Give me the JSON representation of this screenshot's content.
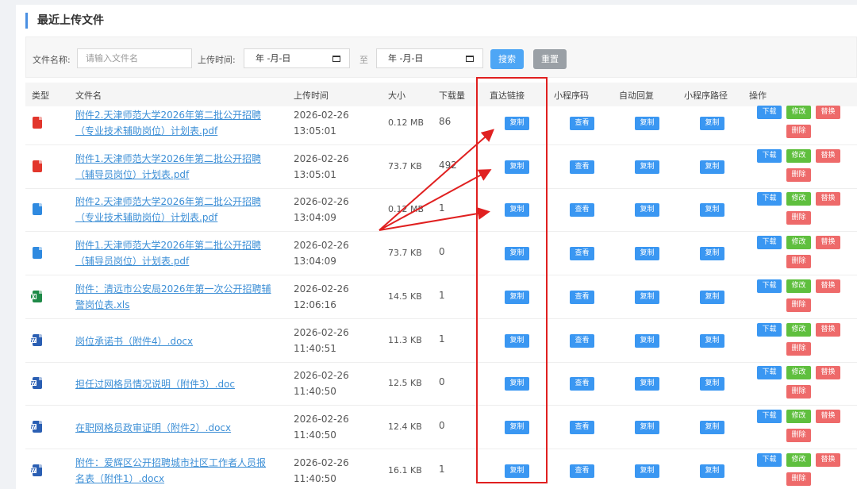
{
  "title": "最近上传文件",
  "filter": {
    "name_label": "文件名称:",
    "name_placeholder": "请输入文件名",
    "time_label": "上传时间:",
    "date_from": "年 -月-日",
    "to_label": "至",
    "date_to": "年 -月-日",
    "search": "搜索",
    "reset": "重置"
  },
  "columns": {
    "type": "类型",
    "name": "文件名",
    "time": "上传时间",
    "size": "大小",
    "downloads": "下载量",
    "direct_link": "直达链接",
    "mini_code": "小程序码",
    "auto_reply": "自动回复",
    "mini_path": "小程序路径",
    "actions": "操作"
  },
  "buttons": {
    "copy": "复制",
    "view": "查看",
    "download": "下载",
    "edit": "修改",
    "replace": "替换",
    "delete": "删除"
  },
  "rows": [
    {
      "type": "pdf",
      "name": "附件2.天津师范大学2026年第二批公开招聘（专业技术辅助岗位）计划表.pdf",
      "date": "2026-02-26",
      "time": "13:05:01",
      "size": "0.12 MB",
      "downloads": "86"
    },
    {
      "type": "pdf",
      "name": "附件1.天津师范大学2026年第二批公开招聘（辅导员岗位）计划表.pdf",
      "date": "2026-02-26",
      "time": "13:05:01",
      "size": "73.7 KB",
      "downloads": "492"
    },
    {
      "type": "doc-blue",
      "name": "附件2.天津师范大学2026年第二批公开招聘（专业技术辅助岗位）计划表.pdf",
      "date": "2026-02-26",
      "time": "13:04:09",
      "size": "0.12 MB",
      "downloads": "1"
    },
    {
      "type": "doc-blue",
      "name": "附件1.天津师范大学2026年第二批公开招聘（辅导员岗位）计划表.pdf",
      "date": "2026-02-26",
      "time": "13:04:09",
      "size": "73.7 KB",
      "downloads": "0"
    },
    {
      "type": "xls",
      "name": "附件：清远市公安局2026年第一次公开招聘辅警岗位表.xls",
      "date": "2026-02-26",
      "time": "12:06:16",
      "size": "14.5 KB",
      "downloads": "1"
    },
    {
      "type": "word",
      "name": "岗位承诺书（附件4）.docx",
      "date": "2026-02-26",
      "time": "11:40:51",
      "size": "11.3 KB",
      "downloads": "1"
    },
    {
      "type": "word",
      "name": "担任过网格员情况说明（附件3）.doc",
      "date": "2026-02-26",
      "time": "11:40:50",
      "size": "12.5 KB",
      "downloads": "0"
    },
    {
      "type": "word",
      "name": "在职网格员政审证明（附件2）.docx",
      "date": "2026-02-26",
      "time": "11:40:50",
      "size": "12.4 KB",
      "downloads": "0"
    },
    {
      "type": "word",
      "name": "附件：爱辉区公开招聘城市社区工作者人员报名表（附件1）.docx",
      "date": "2026-02-26",
      "time": "11:40:50",
      "size": "16.1 KB",
      "downloads": "1"
    }
  ],
  "icon_colors": {
    "pdf": "#e2362c",
    "doc-blue": "#2f8ae0",
    "xls": "#1f8a48",
    "word": "#2b5fb3"
  }
}
